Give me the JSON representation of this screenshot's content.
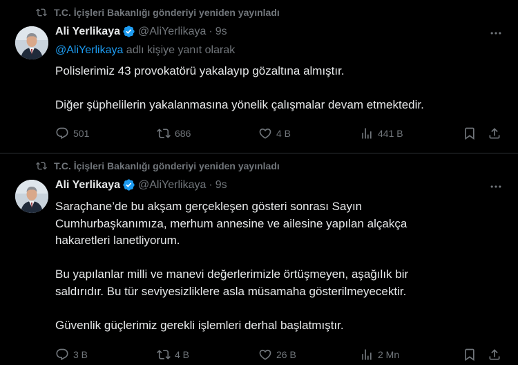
{
  "tweets": [
    {
      "repost_label": "T.C. İçişleri Bakanlığı gönderiyi yeniden yayınladı",
      "author_name": "Ali Yerlikaya",
      "author_handle": "@AliYerlikaya",
      "dot": "·",
      "time": "9s",
      "reply_mention": "@AliYerlikaya",
      "reply_suffix": " adlı kişiye yanıt olarak",
      "body": "Polislerimiz 43 provokatörü yakalayıp gözaltına almıştır.\n\nDiğer şüphelilerin yakalanmasına yönelik çalışmalar devam etmektedir.",
      "stats": {
        "replies": "501",
        "reposts": "686",
        "likes": "4 B",
        "views": "441 B"
      }
    },
    {
      "repost_label": "T.C. İçişleri Bakanlığı gönderiyi yeniden yayınladı",
      "author_name": "Ali Yerlikaya",
      "author_handle": "@AliYerlikaya",
      "dot": "·",
      "time": "9s",
      "body": "Saraçhane’de bu akşam gerçekleşen gösteri sonrası Sayın\nCumhurbaşkanımıza, merhum annesine ve ailesine yapılan alçakça\nhakaretleri lanetliyorum.\n\nBu yapılanlar milli ve manevi değerlerimizle örtüşmeyen, aşağılık bir\nsaldırıdır. Bu tür seviyesizliklere asla müsamaha gösterilmeyecektir.\n\nGüvenlik güçlerimiz gerekli işlemleri derhal başlatmıştır.",
      "stats": {
        "replies": "3 B",
        "reposts": "4 B",
        "likes": "26 B",
        "views": "2 Mn"
      }
    }
  ],
  "colors": {
    "background": "#000000",
    "text": "#e7e9ea",
    "muted": "#71767b",
    "link": "#1d9bf0",
    "verified": "#1d9bf0",
    "divider": "#2f3336"
  },
  "icons": [
    "repost-icon",
    "verified-badge-icon",
    "more-icon",
    "reply-icon",
    "like-icon",
    "views-icon",
    "bookmark-icon",
    "share-icon"
  ]
}
